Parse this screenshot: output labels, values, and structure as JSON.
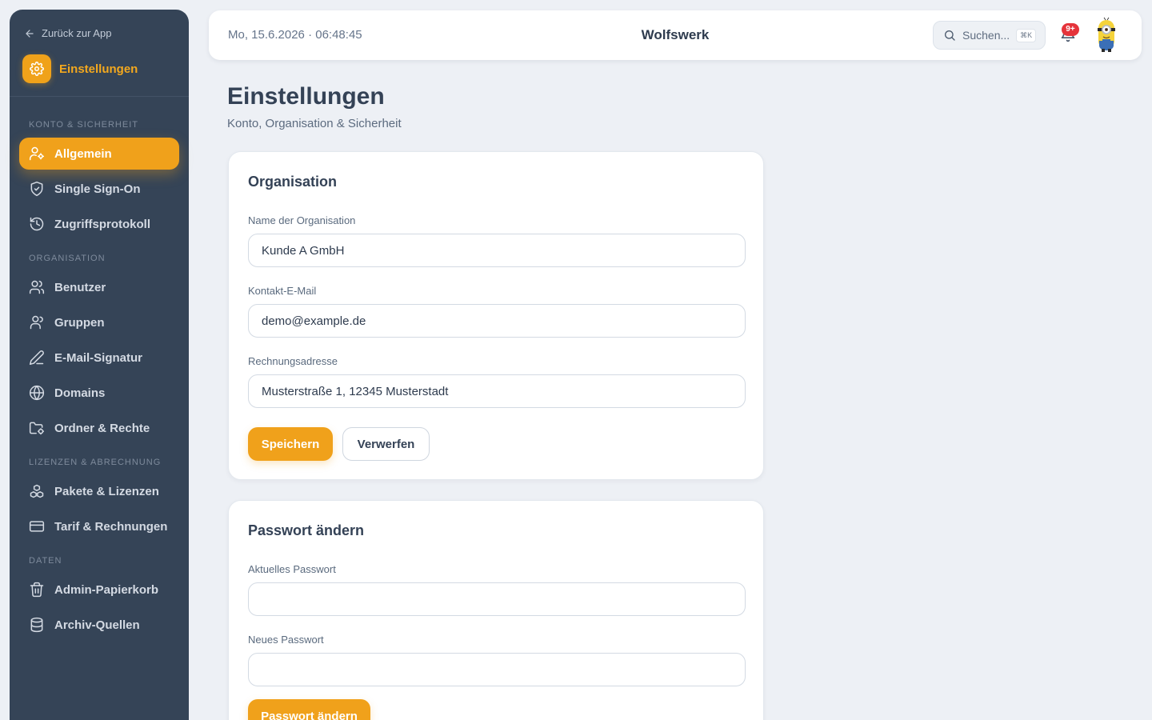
{
  "sidebar": {
    "back_label": "Zurück zur App",
    "settings_title": "Einstellungen",
    "sections": [
      {
        "label": "KONTO & SICHERHEIT"
      },
      {
        "label": "ORGANISATION"
      },
      {
        "label": "LIZENZEN & ABRECHNUNG"
      },
      {
        "label": "DATEN"
      }
    ],
    "items": [
      {
        "label": "Allgemein",
        "icon": "user-cog-icon",
        "active": true
      },
      {
        "label": "Single Sign-On",
        "icon": "shield-check-icon"
      },
      {
        "label": "Zugriffsprotokoll",
        "icon": "history-icon"
      },
      {
        "label": "Benutzer",
        "icon": "users-icon"
      },
      {
        "label": "Gruppen",
        "icon": "group-icon"
      },
      {
        "label": "E-Mail-Signatur",
        "icon": "pen-icon"
      },
      {
        "label": "Domains",
        "icon": "globe-icon"
      },
      {
        "label": "Ordner & Rechte",
        "icon": "folder-lock-icon"
      },
      {
        "label": "Pakete & Lizenzen",
        "icon": "boxes-icon"
      },
      {
        "label": "Tarif & Rechnungen",
        "icon": "credit-card-icon"
      },
      {
        "label": "Admin-Papierkorb",
        "icon": "trash-icon"
      },
      {
        "label": "Archiv-Quellen",
        "icon": "database-icon"
      }
    ]
  },
  "header": {
    "datetime": "Mo, 15.6.2026 · 06:48:45",
    "brand": "Wolfswerk",
    "search_placeholder": "Suchen...",
    "search_shortcut": "⌘K",
    "notification_count": "9+"
  },
  "page": {
    "title": "Einstellungen",
    "subtitle": "Konto, Organisation & Sicherheit"
  },
  "organisation_card": {
    "title": "Organisation",
    "fields": [
      {
        "label": "Name der Organisation",
        "value": "Kunde A GmbH"
      },
      {
        "label": "Kontakt-E-Mail",
        "value": "demo@example.de"
      },
      {
        "label": "Rechnungsadresse",
        "value": "Musterstraße 1, 12345 Musterstadt"
      }
    ],
    "save_label": "Speichern",
    "discard_label": "Verwerfen"
  },
  "password_card": {
    "title": "Passwort ändern",
    "current_label": "Aktuelles Passwort",
    "current_value": "",
    "new_label": "Neues Passwort",
    "new_value": "",
    "submit_label": "Passwort ändern"
  },
  "colors": {
    "accent": "#f0a11b",
    "sidebar_bg": "#354457",
    "page_bg": "#edf0f5",
    "badge_red": "#e5343b"
  }
}
